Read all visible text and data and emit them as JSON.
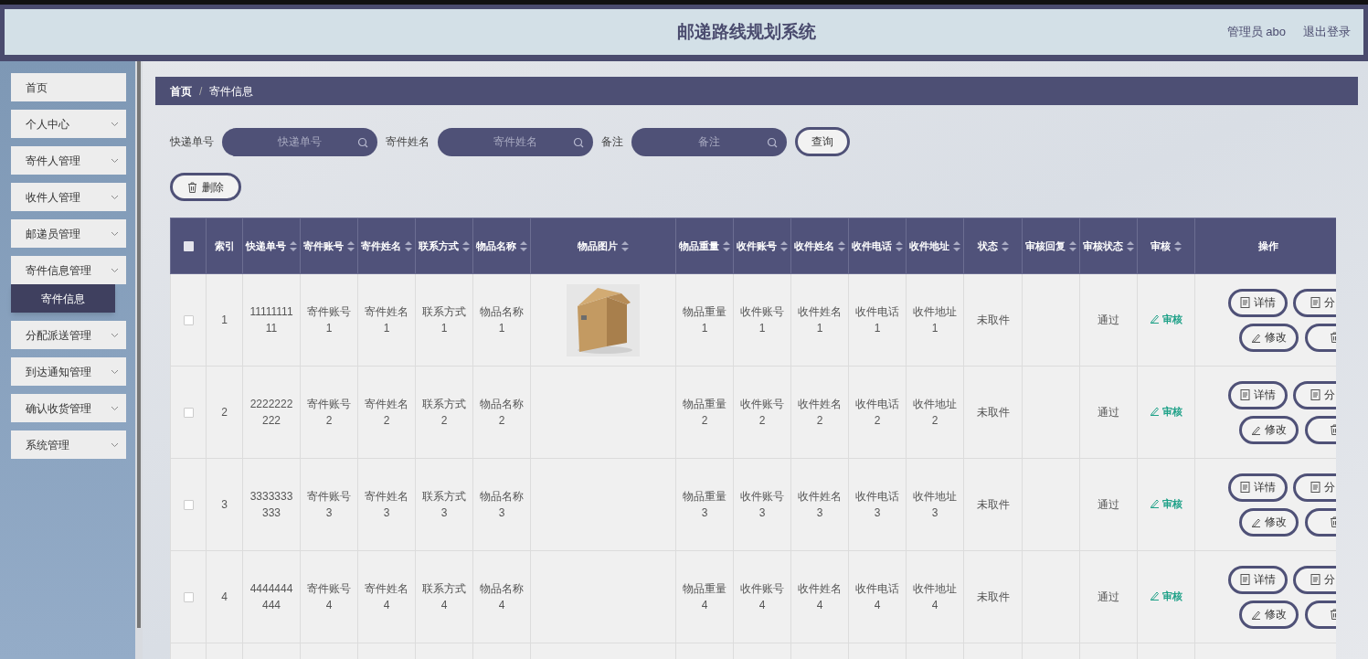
{
  "header": {
    "title": "邮递路线规划系统",
    "user": "管理员 abo",
    "logout": "退出登录"
  },
  "sidebar": {
    "items": [
      {
        "label": "首页",
        "kind": "link"
      },
      {
        "label": "个人中心",
        "kind": "menu"
      },
      {
        "label": "寄件人管理",
        "kind": "menu"
      },
      {
        "label": "收件人管理",
        "kind": "menu"
      },
      {
        "label": "邮递员管理",
        "kind": "menu"
      },
      {
        "label": "寄件信息管理",
        "kind": "menu",
        "expanded": true,
        "children": [
          {
            "label": "寄件信息",
            "selected": true
          }
        ]
      },
      {
        "label": "分配派送管理",
        "kind": "menu"
      },
      {
        "label": "到达通知管理",
        "kind": "menu"
      },
      {
        "label": "确认收货管理",
        "kind": "menu"
      },
      {
        "label": "系统管理",
        "kind": "menu"
      }
    ]
  },
  "breadcrumb": {
    "items": [
      "首页",
      "寄件信息"
    ],
    "separator": "/"
  },
  "search": {
    "fields": [
      {
        "label": "快递单号",
        "placeholder": "快递单号"
      },
      {
        "label": "寄件姓名",
        "placeholder": "寄件姓名"
      },
      {
        "label": "备注",
        "placeholder": "备注"
      }
    ],
    "button": "查询"
  },
  "delete_button": "删除",
  "table": {
    "all_checked": false,
    "columns": [
      {
        "label": "索引",
        "sortable": false
      },
      {
        "label": "快递单号",
        "sortable": true
      },
      {
        "label": "寄件账号",
        "sortable": true
      },
      {
        "label": "寄件姓名",
        "sortable": true
      },
      {
        "label": "联系方式",
        "sortable": true
      },
      {
        "label": "物品名称",
        "sortable": true
      },
      {
        "label": "物品图片",
        "sortable": true
      },
      {
        "label": "物品重量",
        "sortable": true
      },
      {
        "label": "收件账号",
        "sortable": true
      },
      {
        "label": "收件姓名",
        "sortable": true
      },
      {
        "label": "收件电话",
        "sortable": true
      },
      {
        "label": "收件地址",
        "sortable": true
      },
      {
        "label": "状态",
        "sortable": true
      },
      {
        "label": "审核回复",
        "sortable": true
      },
      {
        "label": "审核状态",
        "sortable": true
      },
      {
        "label": "审核",
        "sortable": true,
        "kind": "link"
      },
      {
        "label": "操作",
        "sortable": false,
        "kind": "actions"
      }
    ],
    "rows": [
      {
        "checked": false,
        "cells": [
          "1",
          "1111111111",
          "寄件账号1",
          "寄件姓名1",
          "联系方式1",
          "物品名称1",
          {
            "kind": "picture"
          },
          "物品重量1",
          "收件账号1",
          "收件姓名1",
          "收件电话1",
          "收件地址1",
          "未取件",
          "",
          "通过",
          "审核"
        ],
        "actions": [
          {
            "kind": "text",
            "label": "详情"
          },
          {
            "kind": "text",
            "label": "分"
          },
          {
            "kind": "text",
            "label": "修改"
          },
          {
            "kind": "icon"
          }
        ]
      },
      {
        "checked": false,
        "cells": [
          "2",
          "2222222222",
          "寄件账号2",
          "寄件姓名2",
          "联系方式2",
          "物品名称2",
          null,
          "物品重量2",
          "收件账号2",
          "收件姓名2",
          "收件电话2",
          "收件地址2",
          "未取件",
          "",
          "通过",
          "审核"
        ],
        "actions": [
          {
            "kind": "text",
            "label": "详情"
          },
          {
            "kind": "text",
            "label": "分"
          },
          {
            "kind": "text",
            "label": "修改"
          },
          {
            "kind": "icon"
          }
        ]
      },
      {
        "checked": false,
        "cells": [
          "3",
          "3333333333",
          "寄件账号3",
          "寄件姓名3",
          "联系方式3",
          "物品名称3",
          null,
          "物品重量3",
          "收件账号3",
          "收件姓名3",
          "收件电话3",
          "收件地址3",
          "未取件",
          "",
          "通过",
          "审核"
        ],
        "actions": [
          {
            "kind": "text",
            "label": "详情"
          },
          {
            "kind": "text",
            "label": "分"
          },
          {
            "kind": "text",
            "label": "修改"
          },
          {
            "kind": "icon"
          }
        ]
      },
      {
        "checked": false,
        "cells": [
          "4",
          "4444444444",
          "寄件账号4",
          "寄件姓名4",
          "联系方式4",
          "物品名称4",
          null,
          "物品重量4",
          "收件账号4",
          "收件姓名4",
          "收件电话4",
          "收件地址4",
          "未取件",
          "",
          "通过",
          "审核"
        ],
        "actions": [
          {
            "kind": "text",
            "label": "详情"
          },
          {
            "kind": "text",
            "label": "分"
          },
          {
            "kind": "text",
            "label": "修改"
          },
          {
            "kind": "icon"
          }
        ]
      }
    ]
  }
}
